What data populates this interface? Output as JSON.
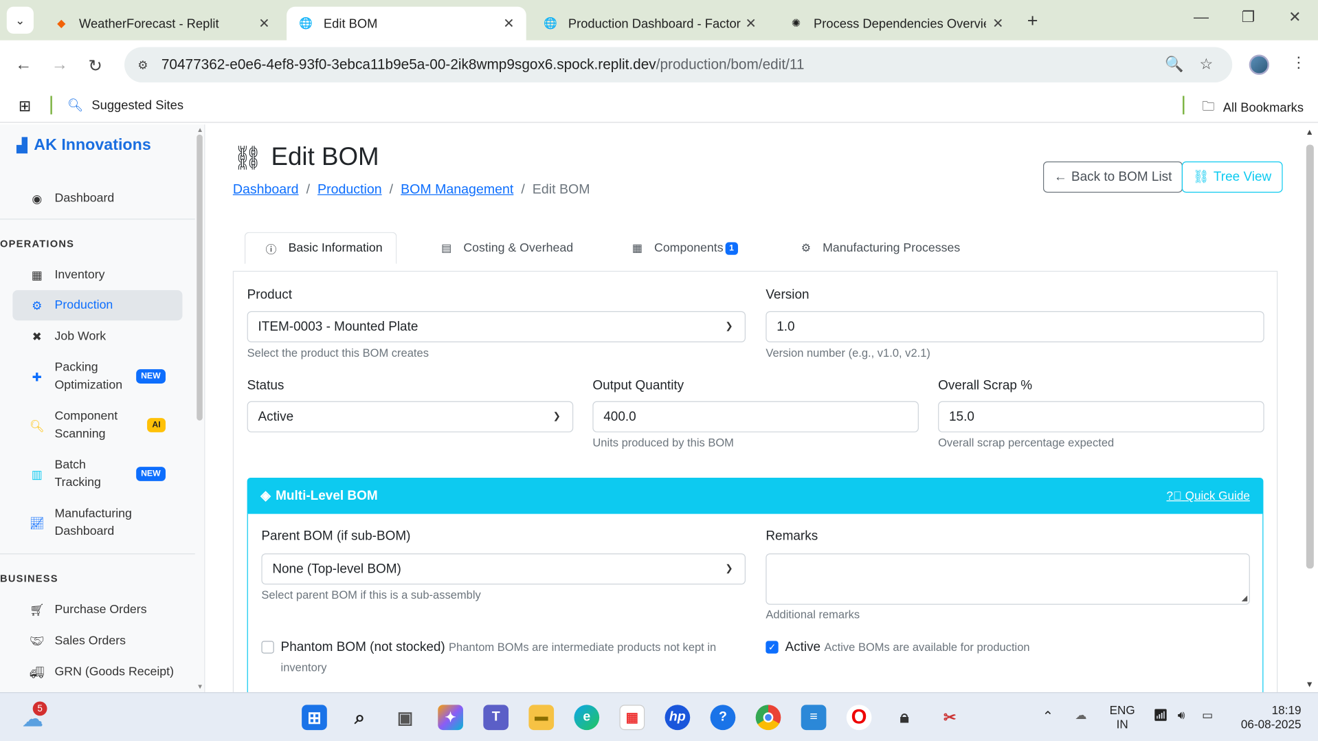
{
  "browser": {
    "tabs": [
      {
        "title": "WeatherForecast - Replit",
        "active": false
      },
      {
        "title": "Edit BOM",
        "active": true
      },
      {
        "title": "Production Dashboard - Factory",
        "active": false
      },
      {
        "title": "Process Dependencies Overview",
        "active": false
      }
    ],
    "url_host": "70477362-e0e6-4ef8-93f0-3ebca11b9e5a-00-2ik8wmp9sgox6.spock.replit.dev",
    "url_path": "/production/bom/edit/11",
    "bookmarks_left": "Suggested Sites",
    "bookmarks_right": "All Bookmarks"
  },
  "sidebar": {
    "brand": "AK Innovations",
    "dashboard": "Dashboard",
    "section_operations": "OPERATIONS",
    "operations": [
      {
        "label": "Inventory",
        "icon": "boxes-icon"
      },
      {
        "label": "Production",
        "icon": "gears-icon",
        "active": true
      },
      {
        "label": "Job Work",
        "icon": "tools-icon"
      },
      {
        "label": "Packing Optimization",
        "icon": "puzzle-icon",
        "badge": "NEW"
      },
      {
        "label": "Component Scanning",
        "icon": "search-icon",
        "badge": "AI"
      },
      {
        "label": "Batch Tracking",
        "icon": "barcode-icon",
        "badge": "NEW"
      },
      {
        "label": "Manufacturing Dashboard",
        "icon": "chart-line-icon"
      }
    ],
    "section_business": "BUSINESS",
    "business": [
      {
        "label": "Purchase Orders",
        "icon": "cart-icon"
      },
      {
        "label": "Sales Orders",
        "icon": "handshake-icon"
      },
      {
        "label": "GRN (Goods Receipt)",
        "icon": "truck-icon"
      }
    ]
  },
  "page": {
    "title": "Edit BOM",
    "breadcrumb": [
      "Dashboard",
      "Production",
      "BOM Management",
      "Edit BOM"
    ],
    "back_button": "Back to BOM List",
    "tree_button": "Tree View",
    "tabs": [
      {
        "label": "Basic Information",
        "active": true
      },
      {
        "label": "Costing & Overhead"
      },
      {
        "label": "Components",
        "count": "1"
      },
      {
        "label": "Manufacturing Processes"
      }
    ]
  },
  "form": {
    "product_label": "Product",
    "product_value": "ITEM-0003 - Mounted Plate",
    "product_help": "Select the product this BOM creates",
    "version_label": "Version",
    "version_value": "1.0",
    "version_help": "Version number (e.g., v1.0, v2.1)",
    "status_label": "Status",
    "status_value": "Active",
    "output_label": "Output Quantity",
    "output_value": "400.0",
    "output_help": "Units produced by this BOM",
    "scrap_label": "Overall Scrap %",
    "scrap_value": "15.0",
    "scrap_help": "Overall scrap percentage expected"
  },
  "multilevel": {
    "header": "Multi-Level BOM",
    "quick_guide": "Quick Guide",
    "parent_label": "Parent BOM (if sub-BOM)",
    "parent_value": "None (Top-level BOM)",
    "parent_help": "Select parent BOM if this is a sub-assembly",
    "remarks_label": "Remarks",
    "remarks_value": "",
    "remarks_help": "Additional remarks",
    "phantom_label": "Phantom BOM (not stocked)",
    "phantom_desc": "Phantom BOMs are intermediate products not kept in inventory",
    "phantom_checked": false,
    "active_label": "Active",
    "active_desc": "Active BOMs are available for production",
    "active_checked": true
  },
  "taskbar": {
    "weather_badge": "5",
    "lang_top": "ENG",
    "lang_bottom": "IN",
    "time": "18:19",
    "date": "06-08-2025"
  },
  "colors": {
    "primary": "#0d6efd",
    "info": "#0dcaf0",
    "warning": "#ffc107"
  }
}
